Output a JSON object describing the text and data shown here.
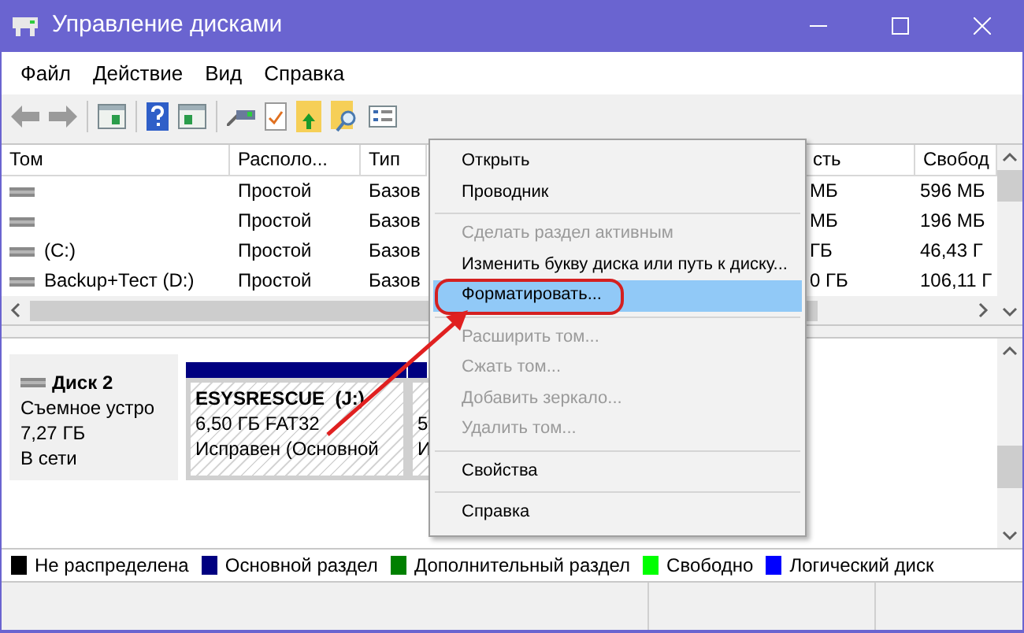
{
  "window": {
    "title": "Управление дисками"
  },
  "menu_bar": [
    "Файл",
    "Действие",
    "Вид",
    "Справка"
  ],
  "volume_table": {
    "columns": [
      "Том",
      "Располо...",
      "Тип",
      "сть",
      "Свобод"
    ],
    "rows": [
      {
        "layout": "Простой",
        "type": "Базов",
        "column_4": "МБ",
        "free": "596 МБ"
      },
      {
        "layout": "Простой",
        "type": "Базов",
        "column_4": "МБ",
        "free": "196 МБ"
      },
      {
        "volume": "(C:)",
        "layout": "Простой",
        "type": "Базов",
        "column_4": "ГБ",
        "free": "46,43 Г"
      },
      {
        "volume": "Backup+Тест (D:)",
        "layout": "Простой",
        "type": "Базов",
        "column_4": "0 ГБ",
        "free": "106,11 Г"
      }
    ]
  },
  "disk_pane": {
    "disk": {
      "name": "Диск 2",
      "type": "Съемное устро",
      "size": "7,27 ГБ",
      "status": "В сети"
    },
    "partitions": [
      {
        "label": "ESYSRESCUE  (J:)",
        "size": "6,50 ГБ FAT32",
        "status": "Исправен (Основной"
      },
      {
        "size": "5",
        "status": "И"
      }
    ]
  },
  "context_menu": [
    {
      "kind": "item",
      "label": "Открыть",
      "disabled": false,
      "selected": false
    },
    {
      "kind": "item",
      "label": "Проводник",
      "disabled": false,
      "selected": false
    },
    {
      "kind": "separator"
    },
    {
      "kind": "item",
      "label": "Сделать раздел активным",
      "disabled": true,
      "selected": false
    },
    {
      "kind": "item",
      "label": "Изменить букву диска или путь к диску...",
      "disabled": false,
      "selected": false
    },
    {
      "kind": "item",
      "label": "Форматировать...",
      "disabled": false,
      "selected": true
    },
    {
      "kind": "separator"
    },
    {
      "kind": "item",
      "label": "Расширить том...",
      "disabled": true,
      "selected": false
    },
    {
      "kind": "item",
      "label": "Сжать том...",
      "disabled": true,
      "selected": false
    },
    {
      "kind": "item",
      "label": "Добавить зеркало...",
      "disabled": true,
      "selected": false
    },
    {
      "kind": "item",
      "label": "Удалить том...",
      "disabled": true,
      "selected": false
    },
    {
      "kind": "separator"
    },
    {
      "kind": "item",
      "label": "Свойства",
      "disabled": false,
      "selected": false
    },
    {
      "kind": "separator"
    },
    {
      "kind": "item",
      "label": "Справка",
      "disabled": false,
      "selected": false
    }
  ],
  "legend": [
    {
      "label": "Не распределена",
      "color": "#000000"
    },
    {
      "label": "Основной раздел",
      "color": "#000080"
    },
    {
      "label": "Дополнительный раздел",
      "color": "#008000"
    },
    {
      "label": "Свободно",
      "color": "#00ff00"
    },
    {
      "label": "Логический диск",
      "color": "#0000ff"
    }
  ]
}
